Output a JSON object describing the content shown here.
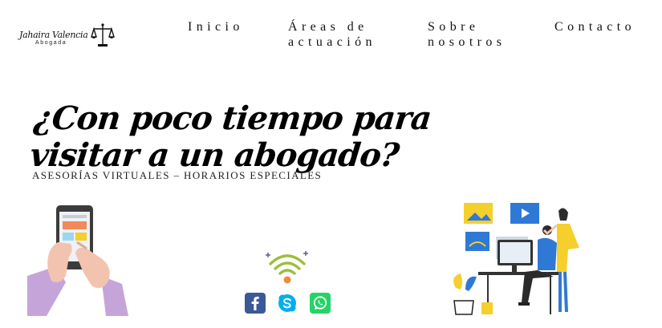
{
  "logo": {
    "name": "Jahaira Valencia",
    "subtitle": "Abogada",
    "icon": "scale-of-justice-icon"
  },
  "nav": {
    "items": [
      {
        "line1": "Inicio",
        "line2": ""
      },
      {
        "line1": "Áreas de",
        "line2": "actuación"
      },
      {
        "line1": "Sobre",
        "line2": "nosotros"
      },
      {
        "line1": "Contacto",
        "line2": ""
      }
    ]
  },
  "hero": {
    "headline_line1": "¿Con poco tiempo para",
    "headline_line2": "visitar a un  abogado?",
    "tagline": "ASESORÍAS VIRTUALES – HORARIOS ESPECIALES"
  },
  "illustrations": [
    "hands-holding-phone",
    "wifi-icon",
    "person-at-computer-with-colleague"
  ],
  "social": [
    {
      "name": "facebook-icon",
      "color": "#3b5998"
    },
    {
      "name": "skype-icon",
      "color": "#00aff0"
    },
    {
      "name": "whatsapp-icon",
      "color": "#25d366"
    }
  ],
  "colors": {
    "accent_yellow": "#f5cf2b",
    "accent_blue": "#2f79d6",
    "lilac": "#c5a5d9",
    "wifi_green": "#9bbf3a"
  }
}
